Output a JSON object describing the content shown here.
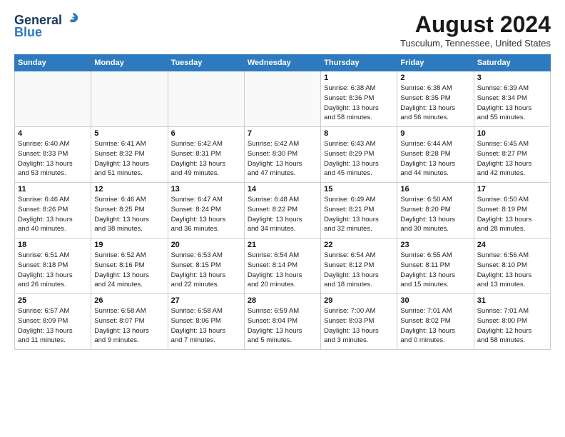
{
  "header": {
    "logo_line1": "General",
    "logo_line2": "Blue",
    "month_year": "August 2024",
    "location": "Tusculum, Tennessee, United States"
  },
  "days_of_week": [
    "Sunday",
    "Monday",
    "Tuesday",
    "Wednesday",
    "Thursday",
    "Friday",
    "Saturday"
  ],
  "weeks": [
    [
      {
        "day": "",
        "info": ""
      },
      {
        "day": "",
        "info": ""
      },
      {
        "day": "",
        "info": ""
      },
      {
        "day": "",
        "info": ""
      },
      {
        "day": "1",
        "info": "Sunrise: 6:38 AM\nSunset: 8:36 PM\nDaylight: 13 hours\nand 58 minutes."
      },
      {
        "day": "2",
        "info": "Sunrise: 6:38 AM\nSunset: 8:35 PM\nDaylight: 13 hours\nand 56 minutes."
      },
      {
        "day": "3",
        "info": "Sunrise: 6:39 AM\nSunset: 8:34 PM\nDaylight: 13 hours\nand 55 minutes."
      }
    ],
    [
      {
        "day": "4",
        "info": "Sunrise: 6:40 AM\nSunset: 8:33 PM\nDaylight: 13 hours\nand 53 minutes."
      },
      {
        "day": "5",
        "info": "Sunrise: 6:41 AM\nSunset: 8:32 PM\nDaylight: 13 hours\nand 51 minutes."
      },
      {
        "day": "6",
        "info": "Sunrise: 6:42 AM\nSunset: 8:31 PM\nDaylight: 13 hours\nand 49 minutes."
      },
      {
        "day": "7",
        "info": "Sunrise: 6:42 AM\nSunset: 8:30 PM\nDaylight: 13 hours\nand 47 minutes."
      },
      {
        "day": "8",
        "info": "Sunrise: 6:43 AM\nSunset: 8:29 PM\nDaylight: 13 hours\nand 45 minutes."
      },
      {
        "day": "9",
        "info": "Sunrise: 6:44 AM\nSunset: 8:28 PM\nDaylight: 13 hours\nand 44 minutes."
      },
      {
        "day": "10",
        "info": "Sunrise: 6:45 AM\nSunset: 8:27 PM\nDaylight: 13 hours\nand 42 minutes."
      }
    ],
    [
      {
        "day": "11",
        "info": "Sunrise: 6:46 AM\nSunset: 8:26 PM\nDaylight: 13 hours\nand 40 minutes."
      },
      {
        "day": "12",
        "info": "Sunrise: 6:46 AM\nSunset: 8:25 PM\nDaylight: 13 hours\nand 38 minutes."
      },
      {
        "day": "13",
        "info": "Sunrise: 6:47 AM\nSunset: 8:24 PM\nDaylight: 13 hours\nand 36 minutes."
      },
      {
        "day": "14",
        "info": "Sunrise: 6:48 AM\nSunset: 8:22 PM\nDaylight: 13 hours\nand 34 minutes."
      },
      {
        "day": "15",
        "info": "Sunrise: 6:49 AM\nSunset: 8:21 PM\nDaylight: 13 hours\nand 32 minutes."
      },
      {
        "day": "16",
        "info": "Sunrise: 6:50 AM\nSunset: 8:20 PM\nDaylight: 13 hours\nand 30 minutes."
      },
      {
        "day": "17",
        "info": "Sunrise: 6:50 AM\nSunset: 8:19 PM\nDaylight: 13 hours\nand 28 minutes."
      }
    ],
    [
      {
        "day": "18",
        "info": "Sunrise: 6:51 AM\nSunset: 8:18 PM\nDaylight: 13 hours\nand 26 minutes."
      },
      {
        "day": "19",
        "info": "Sunrise: 6:52 AM\nSunset: 8:16 PM\nDaylight: 13 hours\nand 24 minutes."
      },
      {
        "day": "20",
        "info": "Sunrise: 6:53 AM\nSunset: 8:15 PM\nDaylight: 13 hours\nand 22 minutes."
      },
      {
        "day": "21",
        "info": "Sunrise: 6:54 AM\nSunset: 8:14 PM\nDaylight: 13 hours\nand 20 minutes."
      },
      {
        "day": "22",
        "info": "Sunrise: 6:54 AM\nSunset: 8:12 PM\nDaylight: 13 hours\nand 18 minutes."
      },
      {
        "day": "23",
        "info": "Sunrise: 6:55 AM\nSunset: 8:11 PM\nDaylight: 13 hours\nand 15 minutes."
      },
      {
        "day": "24",
        "info": "Sunrise: 6:56 AM\nSunset: 8:10 PM\nDaylight: 13 hours\nand 13 minutes."
      }
    ],
    [
      {
        "day": "25",
        "info": "Sunrise: 6:57 AM\nSunset: 8:09 PM\nDaylight: 13 hours\nand 11 minutes."
      },
      {
        "day": "26",
        "info": "Sunrise: 6:58 AM\nSunset: 8:07 PM\nDaylight: 13 hours\nand 9 minutes."
      },
      {
        "day": "27",
        "info": "Sunrise: 6:58 AM\nSunset: 8:06 PM\nDaylight: 13 hours\nand 7 minutes."
      },
      {
        "day": "28",
        "info": "Sunrise: 6:59 AM\nSunset: 8:04 PM\nDaylight: 13 hours\nand 5 minutes."
      },
      {
        "day": "29",
        "info": "Sunrise: 7:00 AM\nSunset: 8:03 PM\nDaylight: 13 hours\nand 3 minutes."
      },
      {
        "day": "30",
        "info": "Sunrise: 7:01 AM\nSunset: 8:02 PM\nDaylight: 13 hours\nand 0 minutes."
      },
      {
        "day": "31",
        "info": "Sunrise: 7:01 AM\nSunset: 8:00 PM\nDaylight: 12 hours\nand 58 minutes."
      }
    ]
  ]
}
